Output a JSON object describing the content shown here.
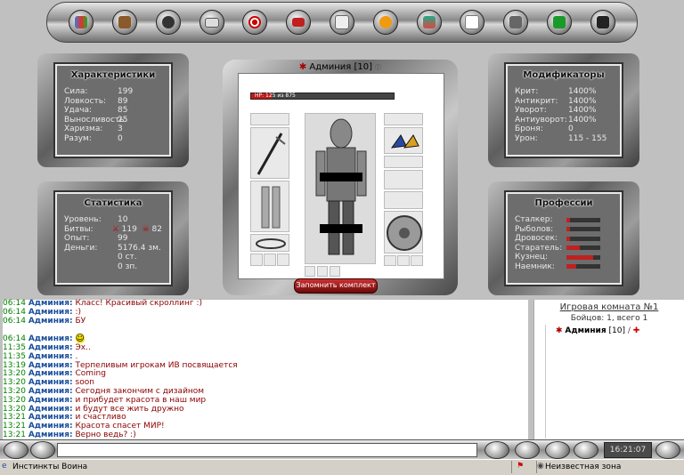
{
  "top_nav": [
    "map-icon",
    "backpack-icon",
    "gear-icon",
    "mail-icon",
    "target-icon",
    "flag-icon",
    "info-icon",
    "star-icon",
    "book-icon",
    "scroll-icon",
    "check-icon",
    "money-icon",
    "exit-icon"
  ],
  "panels": {
    "characteristics": {
      "title": "Характеристики",
      "rows": [
        {
          "k": "Сила:",
          "v": "199"
        },
        {
          "k": "Ловкость:",
          "v": "89"
        },
        {
          "k": "Удача:",
          "v": "85"
        },
        {
          "k": "Выносливость:",
          "v": "25"
        },
        {
          "k": "Харизма:",
          "v": "3"
        },
        {
          "k": "Разум:",
          "v": "0"
        }
      ]
    },
    "modifiers": {
      "title": "Модификаторы",
      "rows": [
        {
          "k": "Крит:",
          "v": "1400%"
        },
        {
          "k": "Антикрит:",
          "v": "1400%"
        },
        {
          "k": "Уворот:",
          "v": "1400%"
        },
        {
          "k": "Антиуворот:",
          "v": "1400%"
        },
        {
          "k": "Броня:",
          "v": "0"
        },
        {
          "k": "Урон:",
          "v": "115 - 155"
        }
      ]
    },
    "stats": {
      "title": "Статистика",
      "level_k": "Уровень:",
      "level_v": "10",
      "battles_k": "Битвы:",
      "wins": "119",
      "losses": "82",
      "exp_k": "Опыт:",
      "exp_v": "99",
      "money_k": "Деньги:",
      "money_v": "5176.4 зм.",
      "money2": "0 ст.",
      "money3": "0 зп."
    },
    "professions": {
      "title": "Профессии",
      "rows": [
        {
          "k": "Сталкер:",
          "level": 0.1
        },
        {
          "k": "Рыболов:",
          "level": 0.1
        },
        {
          "k": "Дровосек:",
          "level": 0.1
        },
        {
          "k": "Старатель:",
          "level": 0.4
        },
        {
          "k": "Кузнец:",
          "level": 0.8
        },
        {
          "k": "Наемник:",
          "level": 0.3
        }
      ]
    }
  },
  "character": {
    "name": "Админия",
    "level": "[10]",
    "hp_text": "HP: 125 из 875",
    "hp_fraction": 0.143,
    "save_button": "Запомнить комплект"
  },
  "chat": [
    {
      "t": "06:14",
      "n": "Админия:",
      "m": "Класс! Красивый скроллинг :)",
      "c": "m"
    },
    {
      "t": "06:14",
      "n": "Админия:",
      "m": ":)",
      "c": "m"
    },
    {
      "t": "06:14",
      "n": "Админия:",
      "m": "БУ",
      "c": "m"
    },
    {
      "t": "",
      "n": "",
      "m": "",
      "c": "m"
    },
    {
      "t": "06:14",
      "n": "Админия:",
      "m": "",
      "c": "m",
      "smile": true
    },
    {
      "t": "11:35",
      "n": "Админия:",
      "m": "Эх..",
      "c": "m"
    },
    {
      "t": "11:35",
      "n": "Админия:",
      "m": ".",
      "c": "m"
    },
    {
      "t": "13:19",
      "n": "Админия:",
      "m": "Терпеливым игрокам ИВ посвящается",
      "c": "m"
    },
    {
      "t": "13:20",
      "n": "Админия:",
      "m": "Coming",
      "c": "m"
    },
    {
      "t": "13:20",
      "n": "Админия:",
      "m": "soon",
      "c": "m"
    },
    {
      "t": "13:20",
      "n": "Админия:",
      "m": "Сегодня закончим с дизайном",
      "c": "m"
    },
    {
      "t": "13:20",
      "n": "Админия:",
      "m": "и прибудет красота в наш мир",
      "c": "m"
    },
    {
      "t": "13:20",
      "n": "Админия:",
      "m": "и будут все жить дружно",
      "c": "m"
    },
    {
      "t": "13:21",
      "n": "Админия:",
      "m": "и счастливо",
      "c": "m"
    },
    {
      "t": "13:21",
      "n": "Админия:",
      "m": "Красота спасет МИР!",
      "c": "m"
    },
    {
      "t": "13:21",
      "n": "Админия:",
      "m": "Верно ведь? :)",
      "c": "m"
    }
  ],
  "room": {
    "title": "Игровая комната №1",
    "count": "Бойцов: 1, всего 1",
    "user": "Админия",
    "user_level": "[10]"
  },
  "clock": "16:21:07",
  "statusbar": {
    "left": "Инстинкты Воина",
    "right": "Неизвестная зона"
  }
}
